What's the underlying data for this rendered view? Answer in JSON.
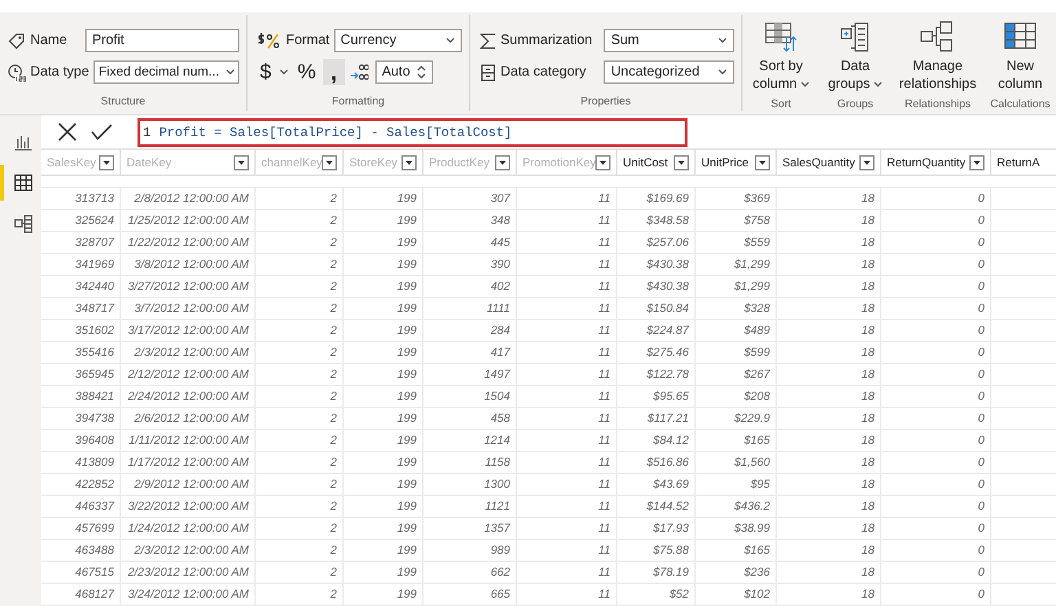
{
  "ribbon": {
    "groups": [
      {
        "kind": "structure",
        "label": "Structure",
        "name_label": "Name",
        "name_value": "Profit",
        "datatype_label": "Data type",
        "datatype_value": "Fixed decimal num..."
      },
      {
        "kind": "formatting",
        "label": "Formatting",
        "format_label": "Format",
        "format_value": "Currency",
        "currency_symbol": "$",
        "percent_symbol": "%",
        "comma_symbol": ",",
        "comma_selected": true,
        "decimals_value": "Auto"
      },
      {
        "kind": "properties",
        "label": "Properties",
        "summarization_label": "Summarization",
        "summarization_value": "Sum",
        "category_label": "Data category",
        "category_value": "Uncategorized"
      },
      {
        "kind": "big",
        "label": "Sort",
        "button": "Sort by column",
        "dropdown": true
      },
      {
        "kind": "big",
        "label": "Groups",
        "button": "Data groups",
        "dropdown": true
      },
      {
        "kind": "big",
        "label": "Relationships",
        "button": "Manage relationships",
        "dropdown": false
      },
      {
        "kind": "big",
        "label": "Calculations",
        "button": "New column",
        "dropdown": false
      }
    ]
  },
  "sidebar": {
    "items": [
      {
        "selected": false
      },
      {
        "selected": true
      },
      {
        "selected": false
      }
    ]
  },
  "formula_bar": {
    "line_number": "1",
    "formula": "Profit = Sales[TotalPrice] - Sales[TotalCost]"
  },
  "table": {
    "columns": [
      {
        "name": "SalesKey",
        "dimmed": true
      },
      {
        "name": "DateKey",
        "dimmed": true
      },
      {
        "name": "channelKey",
        "dimmed": true
      },
      {
        "name": "StoreKey",
        "dimmed": true
      },
      {
        "name": "ProductKey",
        "dimmed": true
      },
      {
        "name": "PromotionKey",
        "dimmed": true
      },
      {
        "name": "UnitCost",
        "dimmed": false
      },
      {
        "name": "UnitPrice",
        "dimmed": false
      },
      {
        "name": "SalesQuantity",
        "dimmed": false
      },
      {
        "name": "ReturnQuantity",
        "dimmed": false
      },
      {
        "name": "ReturnA",
        "dimmed": false
      }
    ],
    "rows": [
      [
        "313713",
        "2/8/2012 12:00:00 AM",
        "2",
        "199",
        "307",
        "11",
        "$169.69",
        "$369",
        "18",
        "0"
      ],
      [
        "325624",
        "1/25/2012 12:00:00 AM",
        "2",
        "199",
        "348",
        "11",
        "$348.58",
        "$758",
        "18",
        "0"
      ],
      [
        "328707",
        "1/22/2012 12:00:00 AM",
        "2",
        "199",
        "445",
        "11",
        "$257.06",
        "$559",
        "18",
        "0"
      ],
      [
        "341969",
        "3/8/2012 12:00:00 AM",
        "2",
        "199",
        "390",
        "11",
        "$430.38",
        "$1,299",
        "18",
        "0"
      ],
      [
        "342440",
        "3/27/2012 12:00:00 AM",
        "2",
        "199",
        "402",
        "11",
        "$430.38",
        "$1,299",
        "18",
        "0"
      ],
      [
        "348717",
        "3/7/2012 12:00:00 AM",
        "2",
        "199",
        "1111",
        "11",
        "$150.84",
        "$328",
        "18",
        "0"
      ],
      [
        "351602",
        "3/17/2012 12:00:00 AM",
        "2",
        "199",
        "284",
        "11",
        "$224.87",
        "$489",
        "18",
        "0"
      ],
      [
        "355416",
        "2/3/2012 12:00:00 AM",
        "2",
        "199",
        "417",
        "11",
        "$275.46",
        "$599",
        "18",
        "0"
      ],
      [
        "365945",
        "2/12/2012 12:00:00 AM",
        "2",
        "199",
        "1497",
        "11",
        "$122.78",
        "$267",
        "18",
        "0"
      ],
      [
        "388421",
        "2/24/2012 12:00:00 AM",
        "2",
        "199",
        "1504",
        "11",
        "$95.65",
        "$208",
        "18",
        "0"
      ],
      [
        "394738",
        "2/6/2012 12:00:00 AM",
        "2",
        "199",
        "458",
        "11",
        "$117.21",
        "$229.9",
        "18",
        "0"
      ],
      [
        "396408",
        "1/11/2012 12:00:00 AM",
        "2",
        "199",
        "1214",
        "11",
        "$84.12",
        "$165",
        "18",
        "0"
      ],
      [
        "413809",
        "1/17/2012 12:00:00 AM",
        "2",
        "199",
        "1158",
        "11",
        "$516.86",
        "$1,560",
        "18",
        "0"
      ],
      [
        "422852",
        "2/9/2012 12:00:00 AM",
        "2",
        "199",
        "1300",
        "11",
        "$43.69",
        "$95",
        "18",
        "0"
      ],
      [
        "446337",
        "3/22/2012 12:00:00 AM",
        "2",
        "199",
        "1121",
        "11",
        "$144.52",
        "$436.2",
        "18",
        "0"
      ],
      [
        "457699",
        "1/24/2012 12:00:00 AM",
        "2",
        "199",
        "1357",
        "11",
        "$17.93",
        "$38.99",
        "18",
        "0"
      ],
      [
        "463488",
        "2/3/2012 12:00:00 AM",
        "2",
        "199",
        "989",
        "11",
        "$75.88",
        "$165",
        "18",
        "0"
      ],
      [
        "467515",
        "2/23/2012 12:00:00 AM",
        "2",
        "199",
        "662",
        "11",
        "$78.19",
        "$236",
        "18",
        "0"
      ],
      [
        "468127",
        "3/24/2012 12:00:00 AM",
        "2",
        "199",
        "665",
        "11",
        "$52",
        "$102",
        "18",
        "0"
      ]
    ]
  }
}
